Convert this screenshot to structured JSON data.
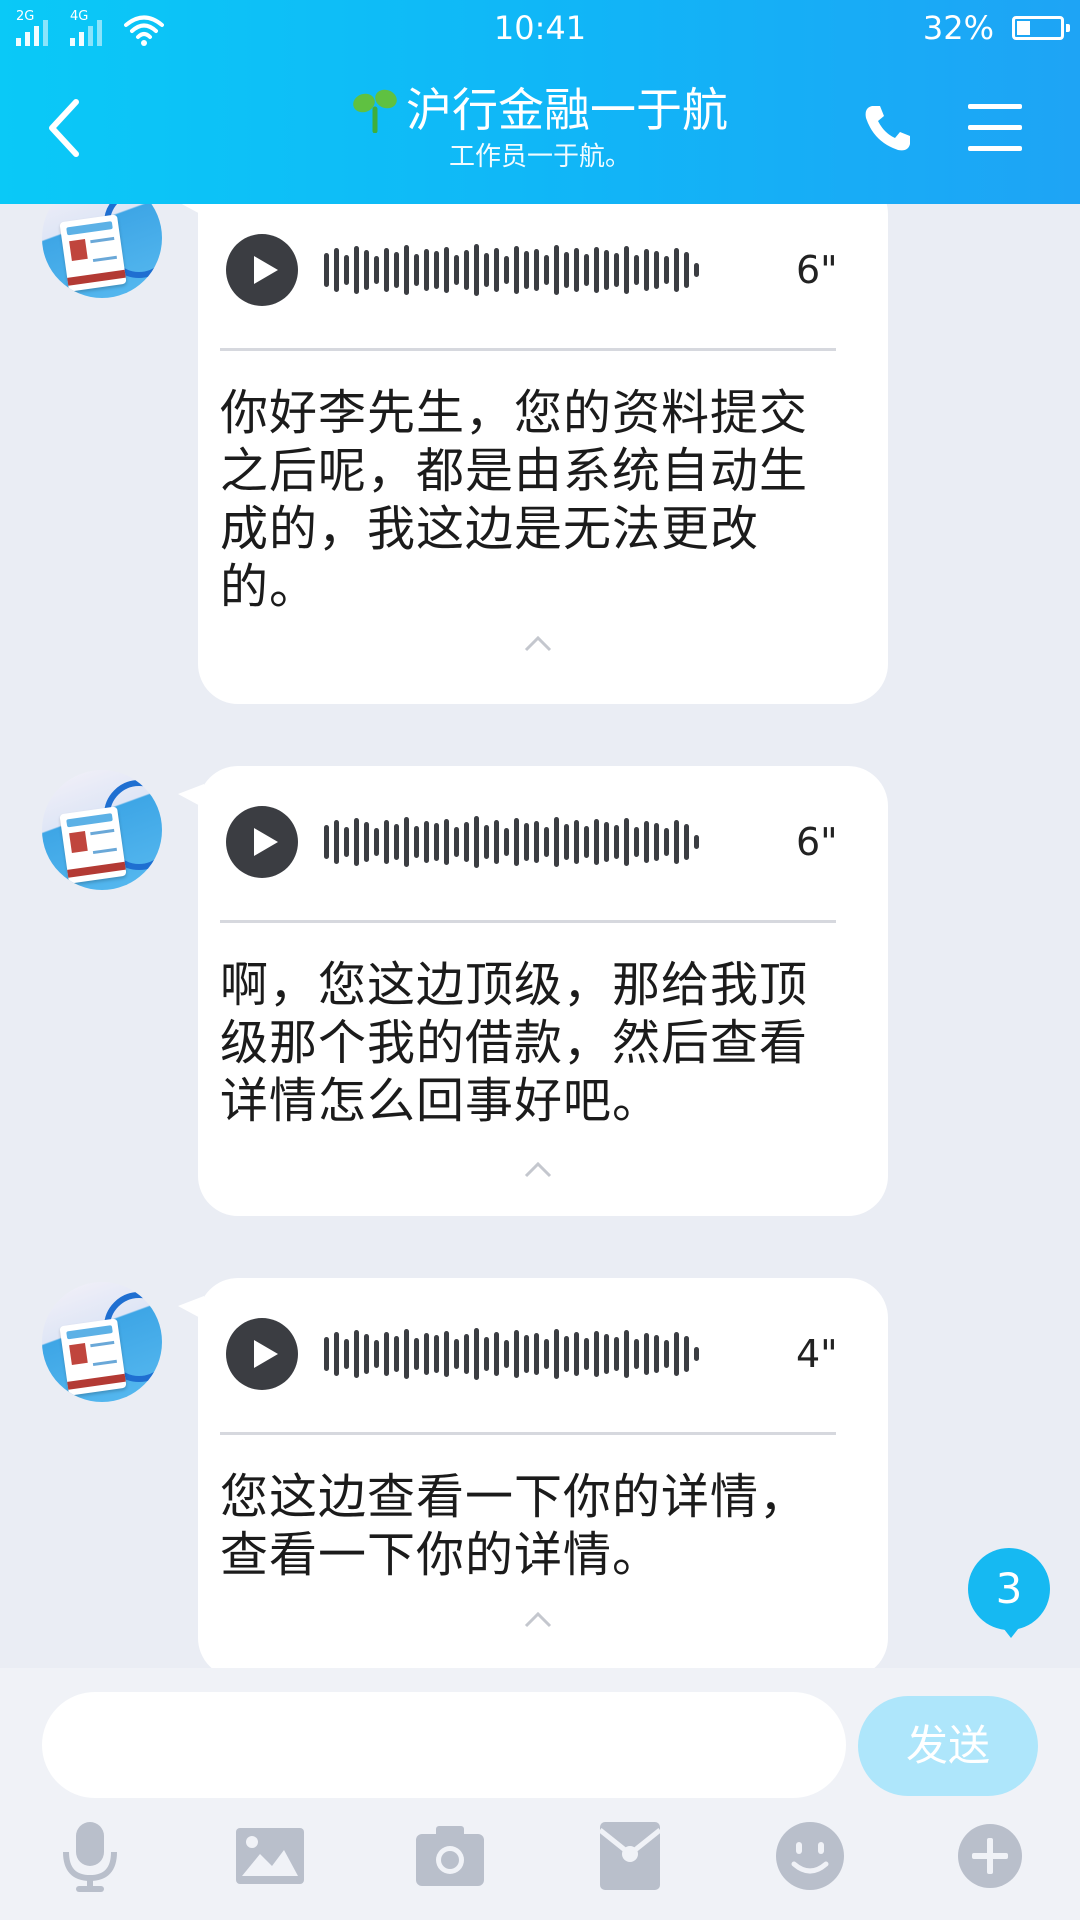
{
  "status_bar": {
    "net1": "2G",
    "net2": "4G",
    "time": "10:41",
    "battery": "32%",
    "battery_level": 0.32
  },
  "header": {
    "title": "沪行金融一于航",
    "subtitle": "工作员一于航。"
  },
  "messages": [
    {
      "duration": "6\"",
      "text": "你好李先生，您的资料提交之后呢，都是由系统自动生成的，我这边是无法更改的。"
    },
    {
      "duration": "6\"",
      "text": "啊，您这边顶级，那给我顶级那个我的借款，然后查看详情怎么回事好吧。"
    },
    {
      "duration": "4\"",
      "text": "您这边查看一下你的详情，查看一下你的详情。"
    }
  ],
  "unread_badge": "3",
  "input": {
    "placeholder": "",
    "send_label": "发送"
  },
  "toolbar": [
    "microphone-icon",
    "image-icon",
    "camera-icon",
    "red-packet-icon",
    "emoji-icon",
    "plus-icon"
  ],
  "colors": {
    "header_start": "#0ac9f7",
    "header_end": "#1ea4f5",
    "badge": "#16b9f2",
    "send_button": "#aee6fb"
  }
}
